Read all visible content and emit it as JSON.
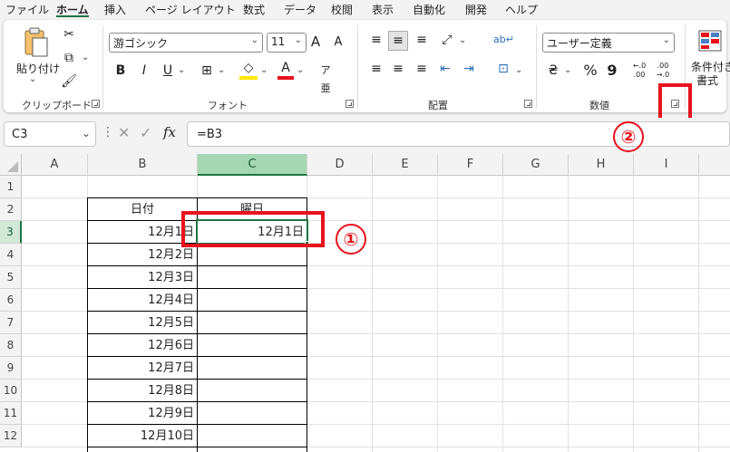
{
  "menu": {
    "tabs": [
      "ファイル",
      "ホーム",
      "挿入",
      "ページ レイアウト",
      "数式",
      "データ",
      "校閲",
      "表示",
      "自動化",
      "開発",
      "ヘルプ"
    ],
    "active_index": 1
  },
  "ribbon": {
    "clipboard": {
      "paste_label": "貼り付け",
      "group_label": "クリップボード"
    },
    "font": {
      "font_name": "游ゴシック",
      "font_size": "11",
      "grow": "A",
      "shrink": "A",
      "bold": "B",
      "italic": "I",
      "underline": "U",
      "group_label": "フォント"
    },
    "alignment": {
      "group_label": "配置"
    },
    "number": {
      "format": "ユーザー定義",
      "percent": "%",
      "comma": "9",
      "inc": "←.0 .00",
      "dec": ".00 →.0",
      "group_label": "数値"
    },
    "styles": {
      "cond_format_label1": "条件付き",
      "cond_format_label2": "書式"
    }
  },
  "formula_bar": {
    "name_box": "C3",
    "formula": "=B3",
    "fx": "fx"
  },
  "columns": [
    "A",
    "B",
    "C",
    "D",
    "E",
    "F",
    "G",
    "H",
    "I"
  ],
  "rows": [
    "1",
    "2",
    "3",
    "4",
    "5",
    "6",
    "7",
    "8",
    "9",
    "10",
    "11",
    "12"
  ],
  "selected_column": "C",
  "selected_row": "3",
  "table": {
    "header_b": "日付",
    "header_c": "曜日",
    "dates": [
      "12月1日",
      "12月2日",
      "12月3日",
      "12月4日",
      "12月5日",
      "12月6日",
      "12月7日",
      "12月8日",
      "12月9日",
      "12月10日"
    ],
    "c3_value": "12月1日"
  },
  "annotations": {
    "marker1": "①",
    "marker2": "②"
  },
  "colors": {
    "accent": "#217346",
    "highlight": "#e8121d"
  }
}
